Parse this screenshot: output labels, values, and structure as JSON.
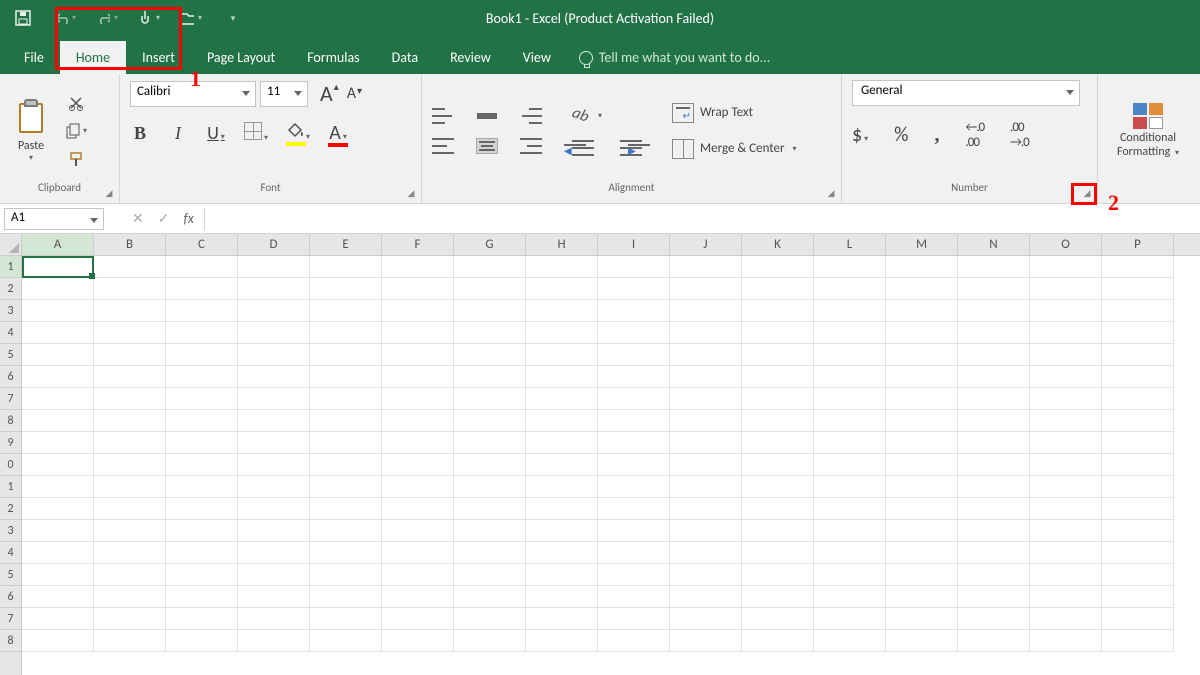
{
  "app": {
    "title": "Book1 - Excel (Product Activation Failed)"
  },
  "tabs": {
    "file": "File",
    "home": "Home",
    "insert": "Insert",
    "pagelayout": "Page Layout",
    "formulas": "Formulas",
    "data": "Data",
    "review": "Review",
    "view": "View",
    "tellme": "Tell me what you want to do..."
  },
  "ribbon": {
    "clipboard": {
      "title": "Clipboard",
      "paste": "Paste"
    },
    "font": {
      "title": "Font",
      "name": "Calibri",
      "size": "11",
      "bold": "B",
      "italic": "I",
      "underline": "U",
      "grow": "A",
      "shrink": "A",
      "fontcolor": "A"
    },
    "alignment": {
      "title": "Alignment",
      "wrap": "Wrap Text",
      "merge": "Merge & Center"
    },
    "number": {
      "title": "Number",
      "format": "General",
      "currency": "$",
      "percent": "%",
      "comma": ",",
      "incdec": ".00",
      "decdec": ".00"
    },
    "styles": {
      "cf_line1": "Conditional",
      "cf_line2": "Formatting"
    }
  },
  "namebox": "A1",
  "columns": [
    "A",
    "B",
    "C",
    "D",
    "E",
    "F",
    "G",
    "H",
    "I",
    "J",
    "K",
    "L",
    "M",
    "N",
    "O",
    "P"
  ],
  "rows": [
    "1",
    "2",
    "3",
    "4",
    "5",
    "6",
    "7",
    "8",
    "9",
    "0",
    "1",
    "2",
    "3",
    "4",
    "5",
    "6",
    "7",
    "8"
  ],
  "annotations": {
    "label1": "1",
    "label2": "2"
  }
}
